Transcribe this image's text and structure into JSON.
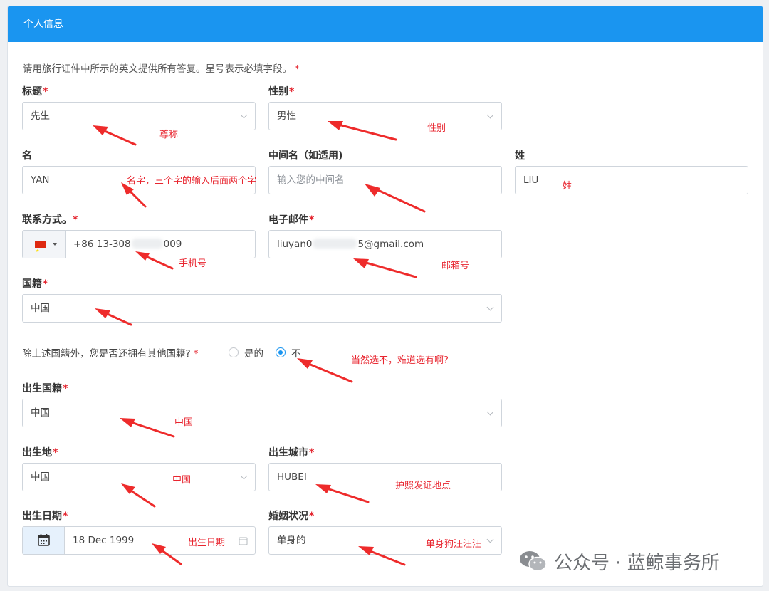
{
  "header": {
    "title": "个人信息"
  },
  "intro": {
    "text": "请用旅行证件中所示的英文提供所有答复。星号表示必填字段。",
    "star": "*"
  },
  "fields": {
    "title": {
      "label": "标题",
      "value": "先生"
    },
    "gender": {
      "label": "性别",
      "value": "男性"
    },
    "given_name": {
      "label": "名",
      "value": "YAN"
    },
    "middle_name": {
      "label": "中间名（如适用)",
      "placeholder": "输入您的中间名"
    },
    "surname": {
      "label": "姓",
      "value": "LIU"
    },
    "phone": {
      "label": "联系方式。",
      "prefix": "+86 13-308",
      "suffix": "009"
    },
    "email": {
      "label": "电子邮件",
      "prefix": "liuyan0",
      "suffix": "5@gmail.com"
    },
    "nationality": {
      "label": "国籍",
      "value": "中国"
    },
    "other_nationality": {
      "question": "除上述国籍外，您是否还拥有其他国籍?",
      "options": [
        "是的",
        "不"
      ],
      "selected": "不"
    },
    "birth_nationality": {
      "label": "出生国籍",
      "value": "中国"
    },
    "birth_place": {
      "label": "出生地",
      "value": "中国"
    },
    "birth_city": {
      "label": "出生城市",
      "value": "HUBEI"
    },
    "birth_date": {
      "label": "出生日期",
      "value": "18 Dec 1999"
    },
    "marital_status": {
      "label": "婚姻状况",
      "value": "单身的"
    }
  },
  "annotations": {
    "title": "尊称",
    "gender": "性别",
    "given_name": "名字，三个字的输入后面两个字",
    "surname": "姓",
    "phone": "手机号",
    "email": "邮箱号",
    "other_nationality": "当然选不，难道选有啊?",
    "birth_nationality": "中国",
    "birth_place": "中国",
    "birth_city": "护照发证地点",
    "birth_date": "出生日期",
    "marital_status": "单身狗汪汪汪"
  },
  "watermark": {
    "text": "公众号 · 蓝鲸事务所"
  },
  "colors": {
    "header": "#1a95f0",
    "required": "#e4232d",
    "annotation": "#e8252f"
  }
}
